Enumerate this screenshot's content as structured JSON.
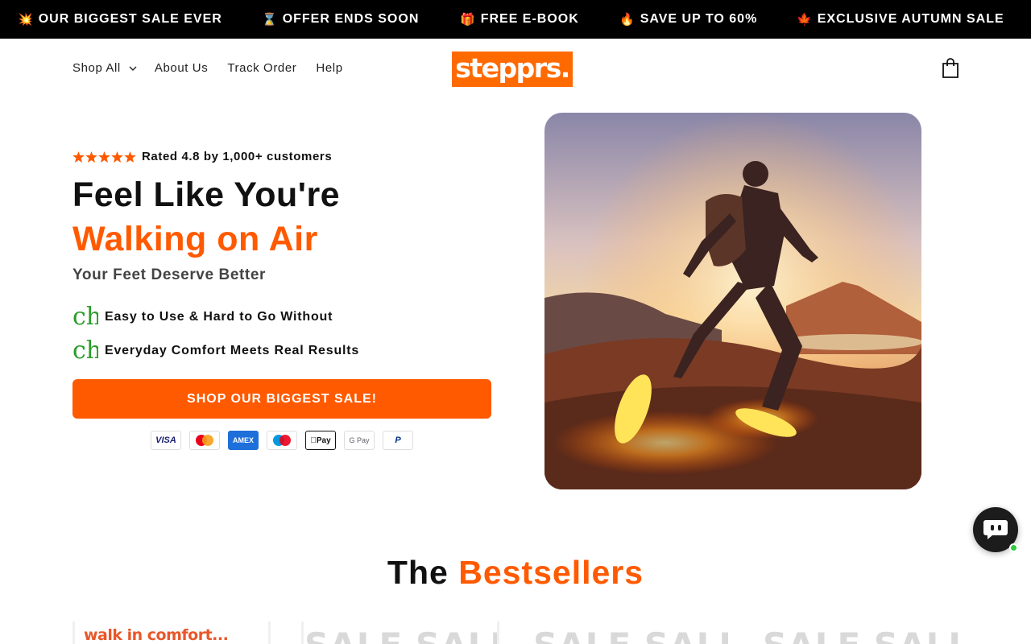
{
  "announcement": {
    "items": [
      {
        "emoji": "💥",
        "text": "OUR BIGGEST SALE EVER"
      },
      {
        "emoji": "⌛",
        "text": "OFFER ENDS SOON"
      },
      {
        "emoji": "🎁",
        "text": "FREE E-BOOK"
      },
      {
        "emoji": "🔥",
        "text": "SAVE UP TO 60%"
      },
      {
        "emoji": "🍁",
        "text": "EXCLUSIVE AUTUMN SALE"
      }
    ]
  },
  "header": {
    "nav": [
      "Shop All",
      "About Us",
      "Track Order",
      "Help"
    ],
    "logo": "stepprs.",
    "cart_icon": "shopping-bag-icon"
  },
  "hero": {
    "rating_text": "Rated 4.8 by 1,000+ customers",
    "stars": 5,
    "title_line1": "Feel Like You're",
    "title_line2": "Walking on Air",
    "subtitle": "Your Feet Deserve Better",
    "features": [
      {
        "icon_text": "check",
        "text": "Easy to Use & Hard to Go Without"
      },
      {
        "icon_text": "check",
        "text": "Everyday Comfort Meets Real Results"
      }
    ],
    "cta_label": "SHOP OUR BIGGEST SALE!",
    "payments": {
      "visa": "VISA",
      "mastercard": "mastercard",
      "amex": "AMEX",
      "maestro": "maestro",
      "applepay": "Pay",
      "googlepay": "G Pay",
      "paypal": "P"
    }
  },
  "bestsellers": {
    "title_part1": "The",
    "title_part2": "Bestsellers",
    "card0_text": "walk in comfort...",
    "sale_text": "SALE SALE"
  },
  "colors": {
    "accent": "#ff5a00",
    "announcement_bg": "#000000",
    "check": "#2a9d2a"
  }
}
